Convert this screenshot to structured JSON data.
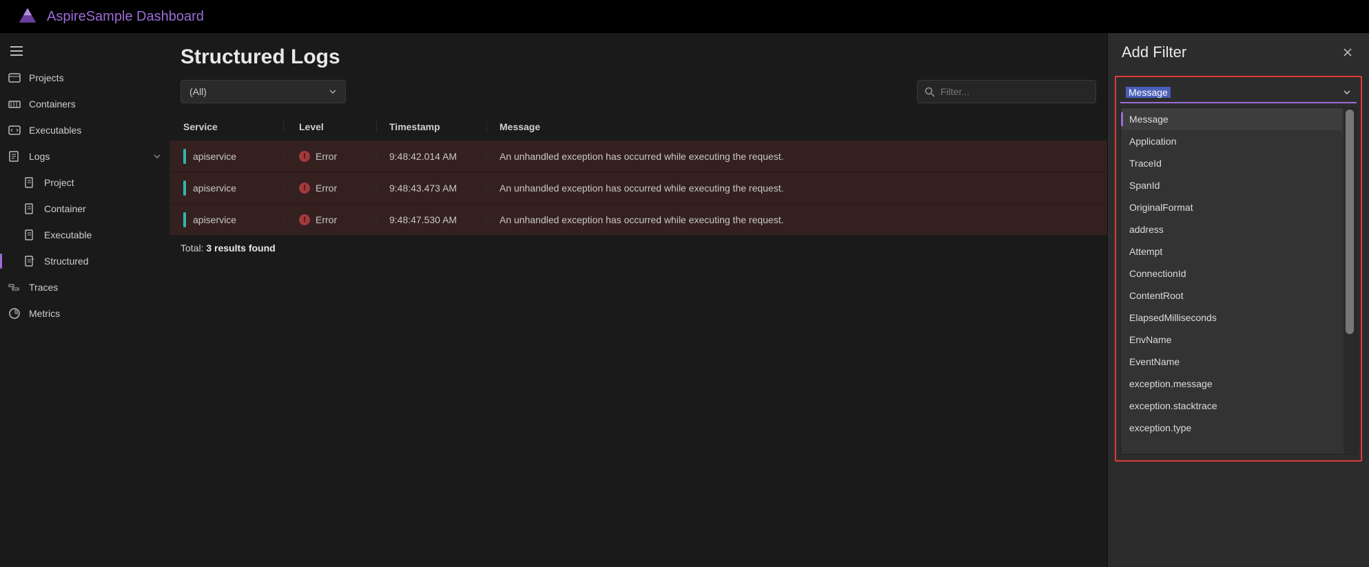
{
  "header": {
    "title": "AspireSample Dashboard"
  },
  "sidebar": {
    "items": [
      {
        "label": "Projects",
        "icon": "projects"
      },
      {
        "label": "Containers",
        "icon": "containers"
      },
      {
        "label": "Executables",
        "icon": "executables"
      },
      {
        "label": "Logs",
        "icon": "logs",
        "expanded": true,
        "children": [
          {
            "label": "Project"
          },
          {
            "label": "Container"
          },
          {
            "label": "Executable"
          },
          {
            "label": "Structured",
            "active": true
          }
        ]
      },
      {
        "label": "Traces",
        "icon": "traces"
      },
      {
        "label": "Metrics",
        "icon": "metrics"
      }
    ]
  },
  "page": {
    "title": "Structured Logs",
    "service_filter": "(All)",
    "search_placeholder": "Filter...",
    "columns": {
      "service": "Service",
      "level": "Level",
      "timestamp": "Timestamp",
      "message": "Message"
    },
    "rows": [
      {
        "service": "apiservice",
        "level": "Error",
        "timestamp": "9:48:42.014 AM",
        "message": "An unhandled exception has occurred while executing the request."
      },
      {
        "service": "apiservice",
        "level": "Error",
        "timestamp": "9:48:43.473 AM",
        "message": "An unhandled exception has occurred while executing the request."
      },
      {
        "service": "apiservice",
        "level": "Error",
        "timestamp": "9:48:47.530 AM",
        "message": "An unhandled exception has occurred while executing the request."
      }
    ],
    "summary_prefix": "Total: ",
    "summary_count": "3 results found"
  },
  "panel": {
    "title": "Add Filter",
    "combo_value": "Message",
    "options": [
      "Message",
      "Application",
      "TraceId",
      "SpanId",
      "OriginalFormat",
      "address",
      "Attempt",
      "ConnectionId",
      "ContentRoot",
      "ElapsedMilliseconds",
      "EnvName",
      "EventName",
      "exception.message",
      "exception.stacktrace",
      "exception.type"
    ]
  }
}
